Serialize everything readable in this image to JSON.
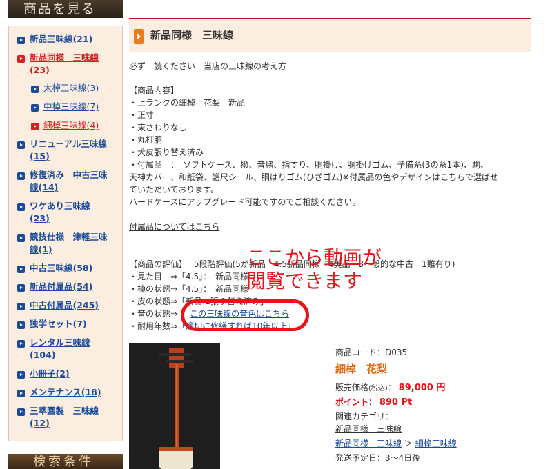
{
  "sidebar": {
    "header": "商品を見る",
    "items": [
      {
        "label": "新品三味線(21)"
      },
      {
        "label": "新品同様　三味線",
        "label2": "(23)"
      },
      {
        "label": "太棹三味線(3)"
      },
      {
        "label": "中棹三味線(7)"
      },
      {
        "label": "細棹三味線(4)"
      },
      {
        "label": "リニューアル三味線",
        "label2": "(15)"
      },
      {
        "label": "修復済み　中古三味",
        "label2": "線(14)"
      },
      {
        "label": "ワケあり三味線",
        "label2": "(23)"
      },
      {
        "label": "競技仕様　津軽三味",
        "label2": "線(1)"
      },
      {
        "label": "中古三味線(58)"
      },
      {
        "label": "新品付属品(54)"
      },
      {
        "label": "中古付属品(245)"
      },
      {
        "label": "独学セット(7)"
      },
      {
        "label": "レンタル三味線",
        "label2": "(104)"
      },
      {
        "label": "小冊子(2)"
      },
      {
        "label": "メンテナンス(18)"
      },
      {
        "label": "三萃園製　三味線",
        "label2": "(12)"
      }
    ],
    "footer": "検索条件"
  },
  "main": {
    "title": "新品同様　三味線",
    "intro_link": "必ず一読ください　当店の三味線の考え方",
    "contents_heading": "【商品内容】",
    "contents_lines": [
      "・上ランクの細棹　花梨　新品",
      "・正寸",
      "・東さわりなし",
      "・丸打胴",
      "・犬皮張り替え済み",
      "・付属品　：　ソフトケース、撥、音緒、指すり、胴掛け、胴掛けゴム、予備糸(3の糸1本)、駒、",
      "天神カバー、和紙袋、譜尺シール、胴はりゴム(ひざゴム)※付属品の色やデザインはこちらで選ばせ",
      "ていただいております。",
      "ハードケースにアップグレード可能ですのでご相談ください。"
    ],
    "accessory_link": "付属品についてはこちら",
    "eval_heading": "【商品の評価】　 5段階評価(5が新品　4.5新品同様　4美品　3一般的な中古　1難有り)",
    "eval_lines": [
      "・見た目　⇒「4.5」：　新品同様",
      "・棹の状態⇒「4.5」：　新品同様",
      "・皮の状態⇒「新品に張り替え済み」"
    ],
    "sound_label": "・音の状態⇒",
    "sound_link": "この三味線の音色はこちら",
    "durability_label": "・耐用年数⇒",
    "durability_value": "「適切に修繕すれば10年以上」",
    "overlay_line1": "ここから動画が",
    "overlay_line2": "閲覧できます",
    "product": {
      "code": "商品コード：D035",
      "name": "細棹　花梨",
      "price_label": "販売価格",
      "price_tax": "(税込)",
      "price_sep": "：",
      "price_value": "89,000 円",
      "points_label": "ポイント：",
      "points_value": "890 Pt",
      "category_label": "関連カテゴリ：",
      "category1": "新品同様　三味線",
      "category2a": "新品同様　三味線",
      "category_sep": "＞",
      "category2b": "細棹三味線",
      "shipping": "発送予定日：3〜4日後"
    }
  },
  "colors": {
    "link": "#1a4a9c",
    "accent_red": "#e8141a",
    "title_orange": "#e06a10",
    "panel_bg": "#fbeee0"
  }
}
